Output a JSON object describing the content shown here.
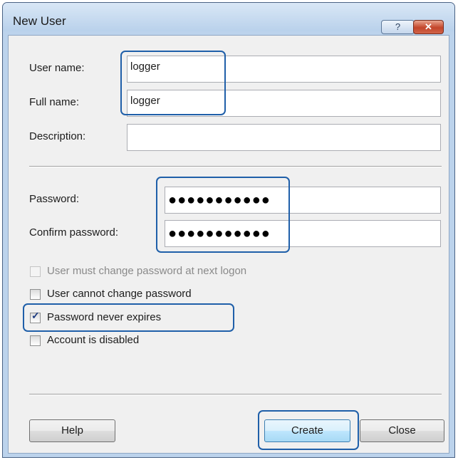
{
  "window": {
    "title": "New User",
    "help_glyph": "?",
    "close_glyph": "✕"
  },
  "fields": {
    "user_name": {
      "label": "User name:",
      "value": "logger"
    },
    "full_name": {
      "label": "Full name:",
      "value": "logger"
    },
    "description": {
      "label": "Description:",
      "value": ""
    },
    "password": {
      "label": "Password:",
      "value": "●●●●●●●●●●●"
    },
    "confirm_password": {
      "label": "Confirm password:",
      "value": "●●●●●●●●●●●"
    }
  },
  "options": [
    {
      "label": "User must change password at next logon",
      "checked": false,
      "enabled": false
    },
    {
      "label": "User cannot change password",
      "checked": false,
      "enabled": true
    },
    {
      "label": "Password never expires",
      "checked": true,
      "enabled": true
    },
    {
      "label": "Account is disabled",
      "checked": false,
      "enabled": true
    }
  ],
  "buttons": {
    "help": "Help",
    "create": "Create",
    "close": "Close"
  },
  "colors": {
    "highlight": "#1f5fa9",
    "title_bar": "#bcd3ec",
    "dialog_bg": "#f0f0f0"
  }
}
